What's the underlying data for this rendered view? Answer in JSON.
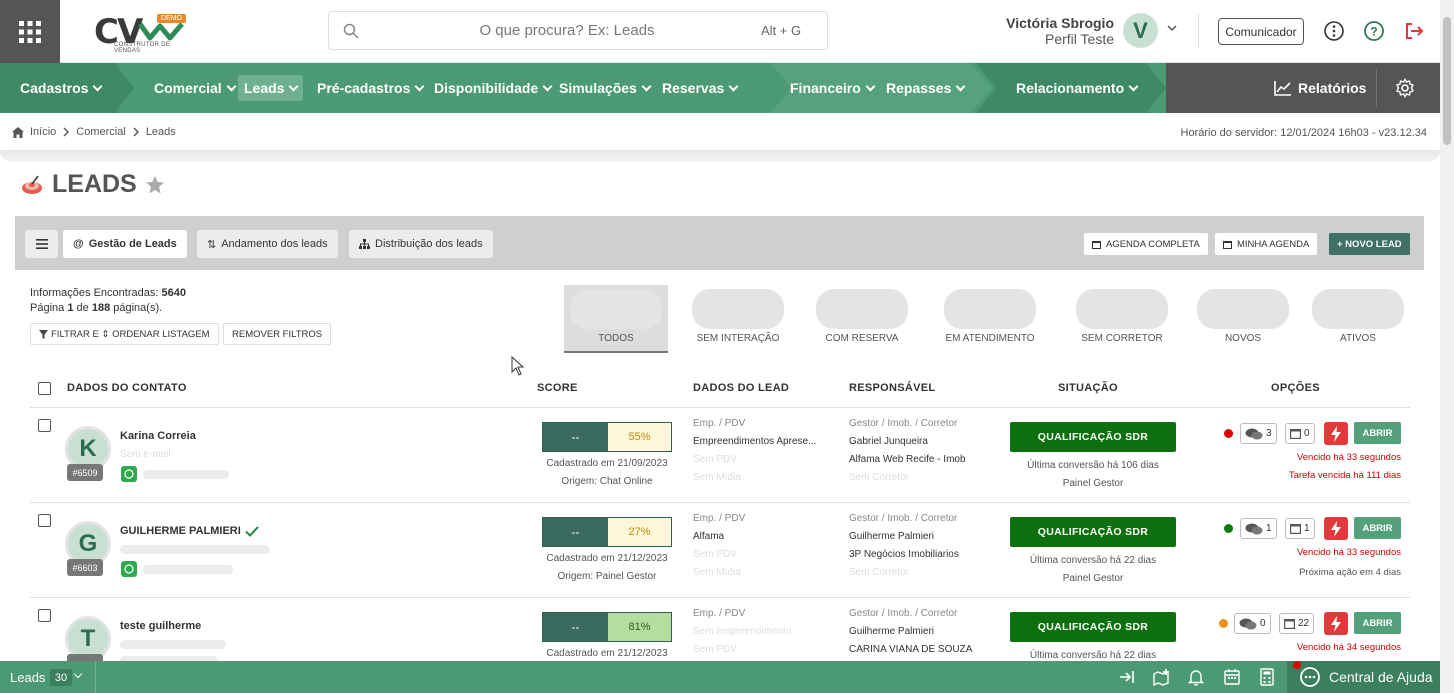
{
  "app": {
    "logo_text": "CV",
    "logo_badge": "DEMO",
    "logo_subtitle": "CONSTRUTOR DE VENDAS"
  },
  "search": {
    "placeholder": "O que procura? Ex: Leads",
    "shortcut": "Alt + G"
  },
  "user": {
    "name": "Victória Sbrogio",
    "profile": "Perfil Teste",
    "initial": "V"
  },
  "header": {
    "comunicador_label": "Comunicador"
  },
  "nav": {
    "items": [
      {
        "label": "Cadastros"
      },
      {
        "label": "Comercial"
      },
      {
        "label": "Leads"
      },
      {
        "label": "Pré-cadastros"
      },
      {
        "label": "Disponibilidade"
      },
      {
        "label": "Simulações"
      },
      {
        "label": "Reservas"
      },
      {
        "label": "Financeiro"
      },
      {
        "label": "Repasses"
      },
      {
        "label": "Relacionamento"
      }
    ],
    "reports_label": "Relatórios"
  },
  "breadcrumb": [
    "Início",
    "Comercial",
    "Leads"
  ],
  "server_time": "Horário do servidor: 12/01/2024 16h03 - v23.12.34",
  "page": {
    "title": "LEADS"
  },
  "toolbar": {
    "tabs": [
      "Gestão de Leads",
      "Andamento dos leads",
      "Distribuição dos leads"
    ],
    "agenda_completa": "AGENDA COMPLETA",
    "minha_agenda": "MINHA AGENDA",
    "novo_lead": "+ NOVO LEAD"
  },
  "info": {
    "found_label": "Informações Encontradas:",
    "found_count": "5640",
    "page_prefix": "Página",
    "page_current": "1",
    "page_of": "de",
    "page_total": "188",
    "page_suffix": "página(s).",
    "filter_label": "FILTRAR E ⇕ ORDENAR LISTAGEM",
    "remove_filters_label": "REMOVER FILTROS"
  },
  "status_tabs": [
    "TODOS",
    "SEM INTERAÇÃO",
    "COM RESERVA",
    "EM ATENDIMENTO",
    "SEM CORRETOR",
    "NOVOS",
    "ATIVOS"
  ],
  "table": {
    "headers": [
      "DADOS DO CONTATO",
      "SCORE",
      "DADOS DO LEAD",
      "RESPONSÁVEL",
      "SITUAÇÃO",
      "OPÇÕES"
    ],
    "rows": [
      {
        "initial": "K",
        "id": "#6509",
        "name": "Karina Correia",
        "email": "Sem e-mail",
        "score_left": "--",
        "score_right": "55%",
        "score_color": "#fdf6d9",
        "score_text_color": "#c08a00",
        "created": "Cadastrado em 21/09/2023",
        "origin": "Origem: Chat Online",
        "emp_label": "Emp. / PDV",
        "emp": "Empreendimentos Aprese...",
        "pdv": "Sem PDV",
        "midia": "Sem Mídia",
        "resp_label": "Gestor / Imob. / Corretor",
        "gestor": "Gabriel Junqueira",
        "imob": "Alfama Web Recife - Imob",
        "corretor": "Sem Corretor",
        "status": "QUALIFICAÇÃO SDR",
        "last_conv": "Última conversão há 106 dias",
        "panel": "Painel Gestor",
        "dot_color": "#e00000",
        "chat_count": "3",
        "cal_count": "0",
        "open_label": "ABRIR",
        "note1": "Vencido há 33 segundos",
        "note2": "Tarefa vencida há 111 dias",
        "note2_red": true,
        "verified": false
      },
      {
        "initial": "G",
        "id": "#6603",
        "name": "GUILHERME PALMIERI",
        "email": "",
        "score_left": "--",
        "score_right": "27%",
        "score_color": "#fdf6d9",
        "score_text_color": "#c08a00",
        "created": "Cadastrado em 21/12/2023",
        "origin": "Origem: Painel Gestor",
        "emp_label": "Emp. / PDV",
        "emp": "Alfama",
        "pdv": "Sem PDV",
        "midia": "Sem Mídia",
        "resp_label": "Gestor / Imob. / Corretor",
        "gestor": "Guilherme Palmieri",
        "imob": "3P Negócios Imobiliarios",
        "corretor": "Sem Corretor",
        "status": "QUALIFICAÇÃO SDR",
        "last_conv": "Última conversão há 22 dias",
        "panel": "Painel Gestor",
        "dot_color": "#0a7a0a",
        "chat_count": "1",
        "cal_count": "1",
        "open_label": "ABRIR",
        "note1": "Vencido há 33 segundos",
        "note2": "Próxima ação em 4 dias",
        "note2_red": false,
        "verified": true
      },
      {
        "initial": "T",
        "id": "",
        "name": "teste guilherme",
        "email": "",
        "score_left": "--",
        "score_right": "81%",
        "score_color": "#b5dd9f",
        "score_text_color": "#2e5e1e",
        "created": "Cadastrado em 21/12/2023",
        "origin": "",
        "emp_label": "Emp. / PDV",
        "emp": "Sem empreendimento",
        "pdv": "Sem PDV",
        "midia": "",
        "resp_label": "Gestor / Imob. / Corretor",
        "gestor": "Guilherme Palmieri",
        "imob": "CARINA VIANA DE SOUZA",
        "corretor": "",
        "status": "QUALIFICAÇÃO SDR",
        "last_conv": "Última conversão há 22 dias",
        "panel": "",
        "dot_color": "#f0901a",
        "chat_count": "0",
        "cal_count": "22",
        "open_label": "ABRIR",
        "note1": "Vencido há 34 segundos",
        "note2": "",
        "note2_red": false,
        "verified": false
      }
    ]
  },
  "footer": {
    "title": "Leads",
    "count": "30",
    "help_label": "Central de Ajuda"
  },
  "colors": {
    "nav_green": "#4c9a74",
    "status_green": "#0e6f0e",
    "primary_dark": "#3e7064",
    "danger": "#e03a3a"
  }
}
